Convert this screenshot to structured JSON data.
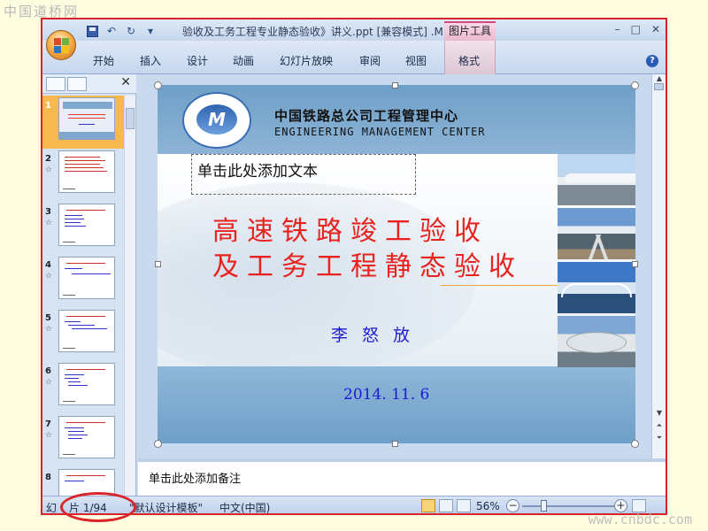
{
  "watermarks": {
    "top_left": "中国道桥网",
    "bottom_right": "www.cnbdc.com"
  },
  "window": {
    "title": "验收及工务工程专业静态验收》讲义.ppt [兼容模式] .M",
    "contextual_tab": "图片工具",
    "controls": [
      "–",
      "□",
      "✕"
    ]
  },
  "ribbon": {
    "tabs": [
      "开始",
      "插入",
      "设计",
      "动画",
      "幻灯片放映",
      "审阅",
      "视图"
    ],
    "contextual_tabs": [
      "格式"
    ],
    "help": "?"
  },
  "thumbnails": {
    "close": "✕",
    "items": [
      {
        "num": "1",
        "star": ""
      },
      {
        "num": "2",
        "star": "☆"
      },
      {
        "num": "3",
        "star": "☆"
      },
      {
        "num": "4",
        "star": "☆"
      },
      {
        "num": "5",
        "star": "☆"
      },
      {
        "num": "6",
        "star": "☆"
      },
      {
        "num": "7",
        "star": "☆"
      },
      {
        "num": "8",
        "star": ""
      }
    ]
  },
  "slide": {
    "org_cn": "中国铁路总公司工程管理中心",
    "org_en": "ENGINEERING MANAGEMENT CENTER",
    "placeholder": "单击此处添加文本",
    "title_line1": "高速铁路竣工验收",
    "title_line2": "及工务工程静态验收",
    "author": "李怒放",
    "date": "2014. 11. 6"
  },
  "notes": {
    "placeholder": "单击此处添加备注"
  },
  "status": {
    "slide_prefix": "幻",
    "slide_counter": "片 1/94",
    "template": "\"默认设计模板\"",
    "language": "中文(中国)",
    "zoom": "56%"
  },
  "colors": {
    "title_red": "#e8231f",
    "author_blue": "#1e1ecf",
    "highlight_red": "#d9242b",
    "selection_orange": "#f7b84e"
  }
}
